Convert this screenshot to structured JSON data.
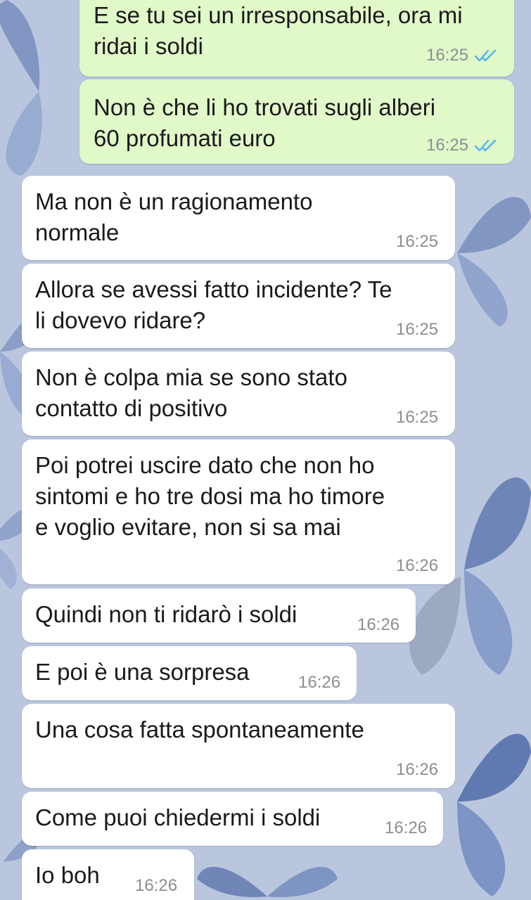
{
  "chat": {
    "messages": [
      {
        "direction": "out",
        "text": "E se tu sei un irresponsabile, ora mi\nridai i soldi",
        "time": "16:25",
        "status": "read"
      },
      {
        "direction": "out",
        "text": "Non è che li ho trovati sugli alberi\n60 profumati euro",
        "time": "16:25",
        "status": "read"
      },
      {
        "direction": "in",
        "text": "Ma non è un ragionamento\nnormale",
        "time": "16:25"
      },
      {
        "direction": "in",
        "text": "Allora se avessi fatto incidente? Te\nli dovevo ridare?",
        "time": "16:25"
      },
      {
        "direction": "in",
        "text": "Non è colpa mia se sono stato\ncontatto di positivo",
        "time": "16:25"
      },
      {
        "direction": "in",
        "text": "Poi potrei uscire dato che non ho\nsintomi e ho tre dosi ma ho timore\ne voglio evitare, non si sa mai",
        "time": "16:26"
      },
      {
        "direction": "in",
        "text": "Quindi non ti ridarò i soldi",
        "time": "16:26"
      },
      {
        "direction": "in",
        "text": "E poi è una sorpresa",
        "time": "16:26"
      },
      {
        "direction": "in",
        "text": "Una cosa fatta spontaneamente",
        "time": "16:26"
      },
      {
        "direction": "in",
        "text": "Come puoi chiedermi i soldi",
        "time": "16:26"
      },
      {
        "direction": "in",
        "text": "Io boh",
        "time": "16:26"
      }
    ]
  },
  "colors": {
    "outgoing_bubble": "#e1f8c9",
    "incoming_bubble": "#ffffff",
    "read_ticks": "#4fb3e8",
    "background": "#b9c6de"
  },
  "icons": {
    "read_receipt": "double-check-icon"
  }
}
